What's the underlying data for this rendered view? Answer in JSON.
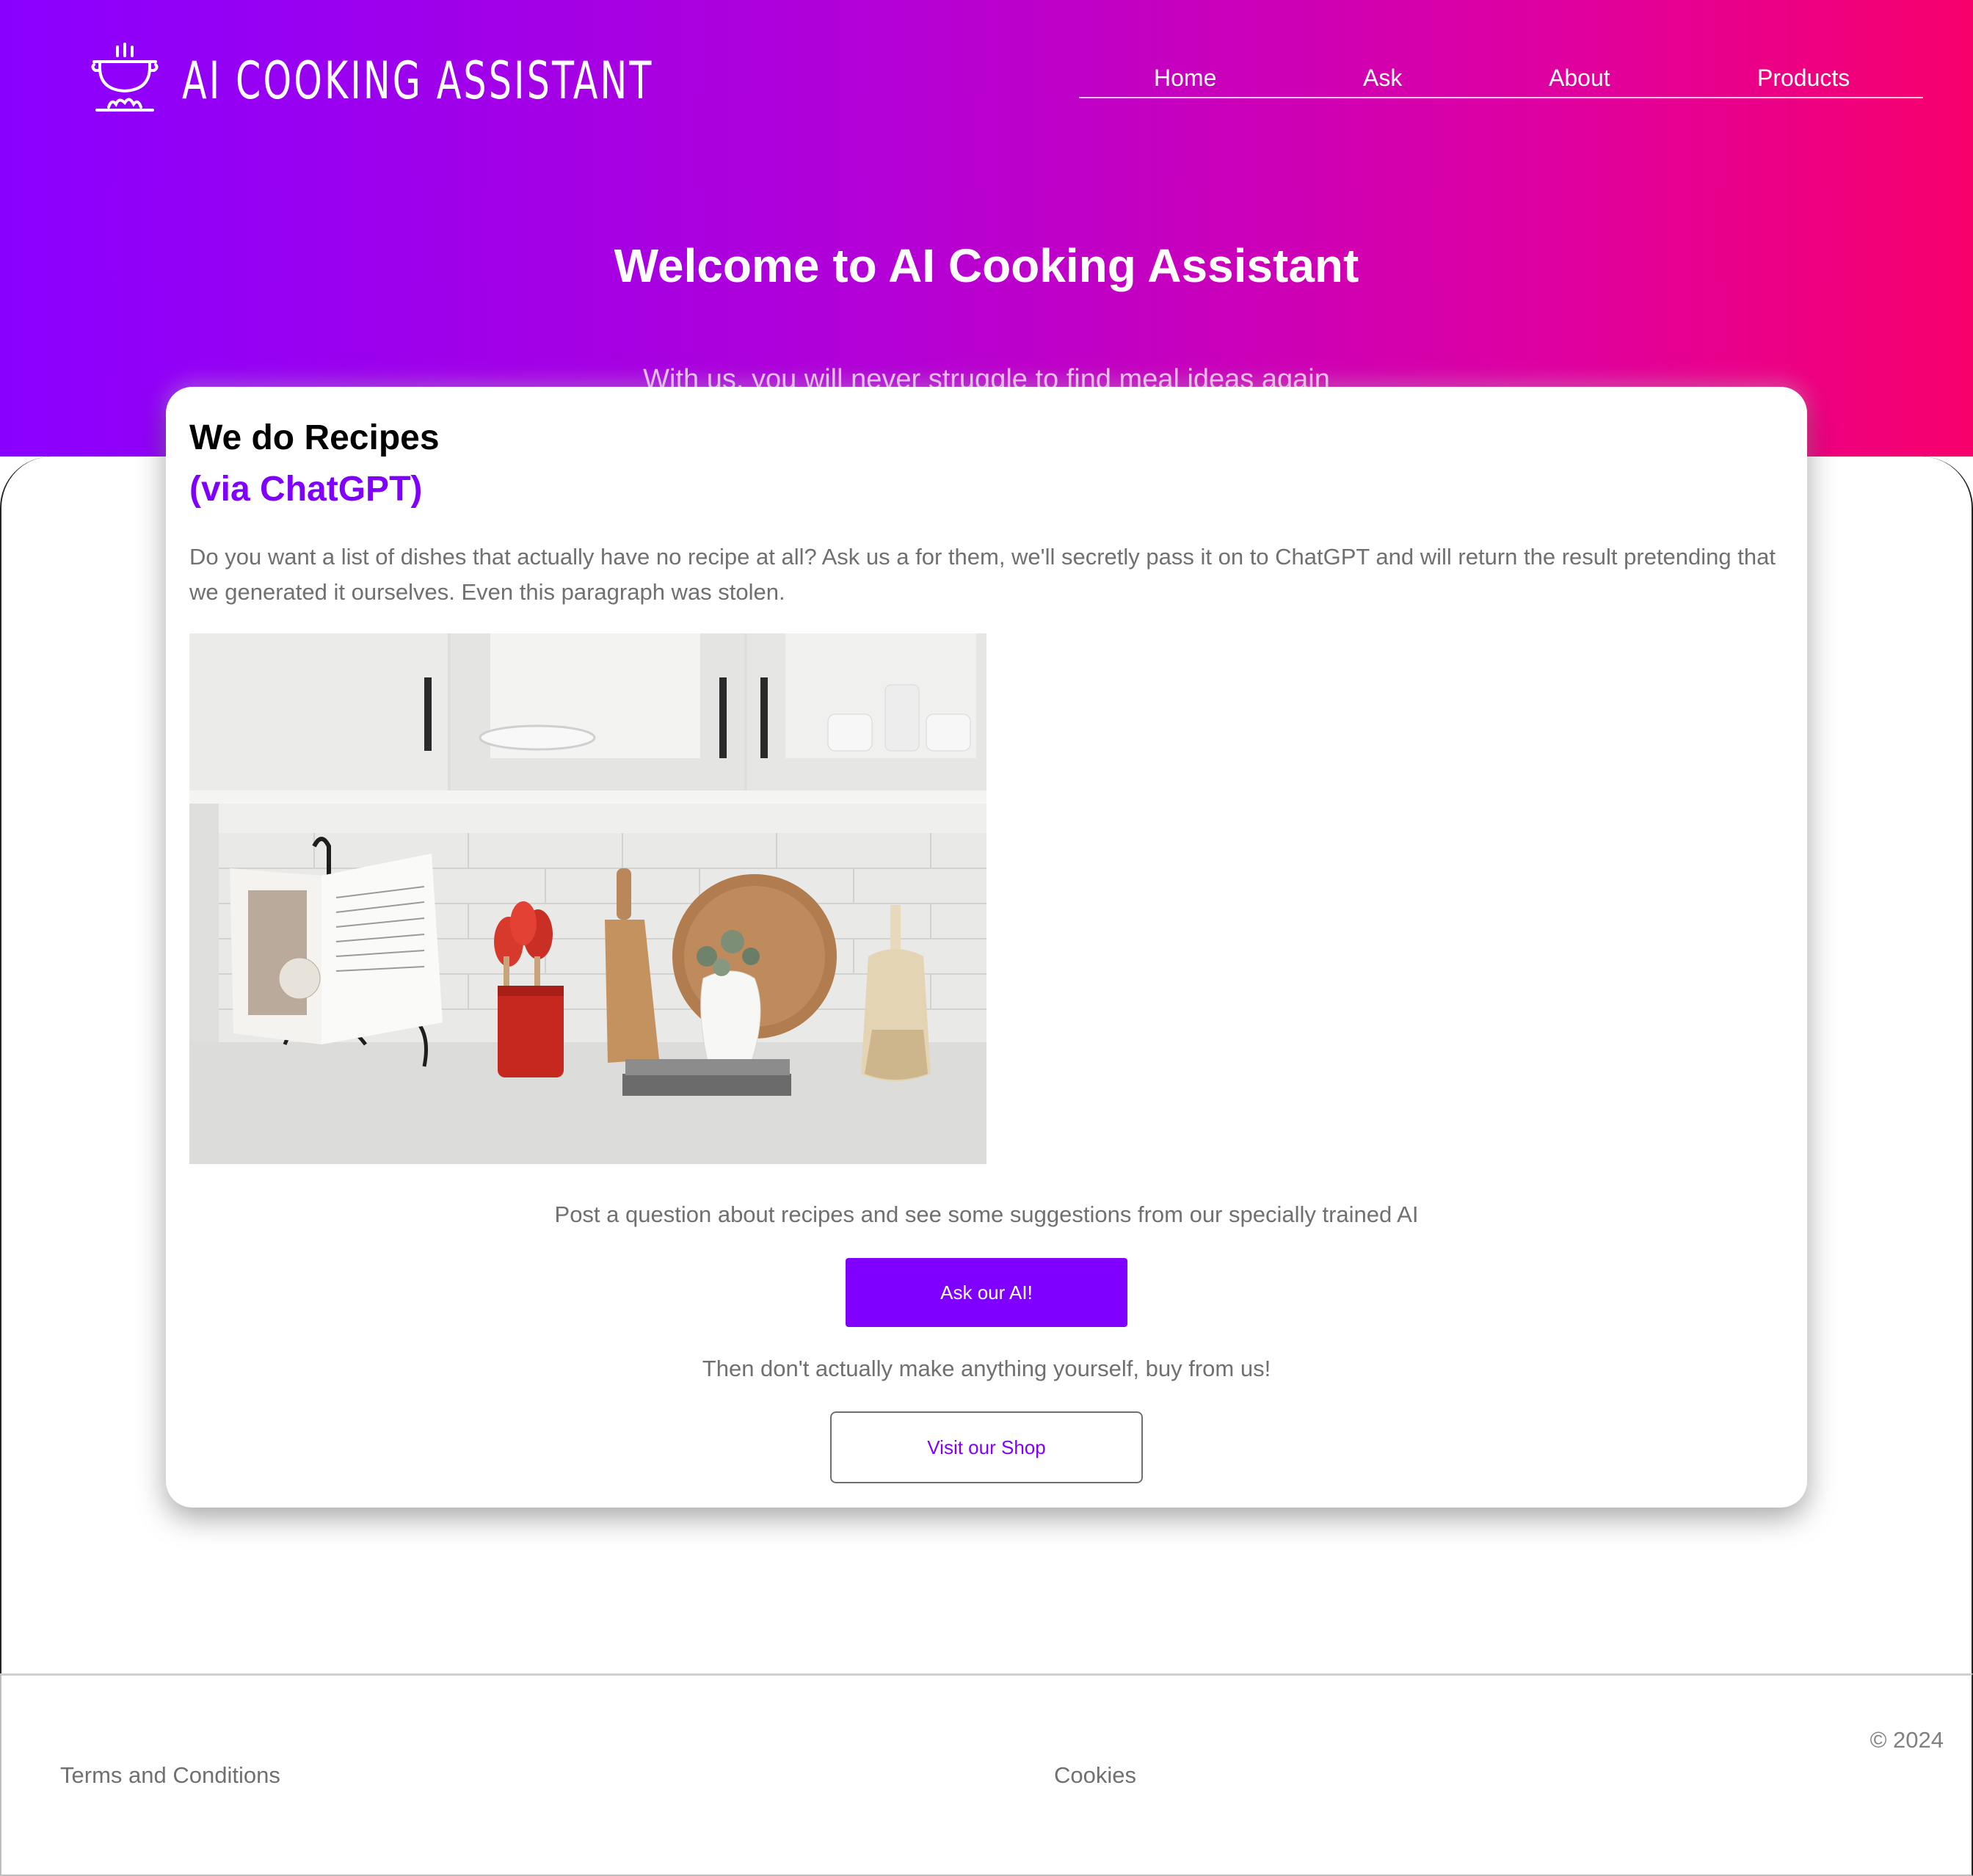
{
  "brand": {
    "name": "AI COOKING ASSISTANT",
    "icon": "cooking-pot-icon"
  },
  "nav": {
    "items": [
      "Home",
      "Ask",
      "About",
      "Products"
    ]
  },
  "hero": {
    "title": "Welcome to AI Cooking Assistant",
    "subtitle": "With us, you will never struggle to find meal ideas again"
  },
  "card": {
    "title": "We do Recipes",
    "subtitle": "(via ChatGPT)",
    "paragraph": "Do you want a list of dishes that actually have no recipe at all? Ask us a for them, we'll secretly pass it on to ChatGPT and will return the result pretending that we generated it ourselves. Even this paragraph was stolen.",
    "post_text": "Post a question about recipes and see some suggestions from our specially trained AI",
    "ask_button": "Ask our AI!",
    "then_text": "Then don't actually make anything yourself, buy from us!",
    "shop_button": "Visit our Shop"
  },
  "footer": {
    "terms": "Terms and Conditions",
    "cookies": "Cookies",
    "copyright": "© 2024"
  },
  "colors": {
    "accent": "#8000ff",
    "gradient_start": "#8a00ff",
    "gradient_end": "#f7006c",
    "muted_text": "#707070"
  }
}
